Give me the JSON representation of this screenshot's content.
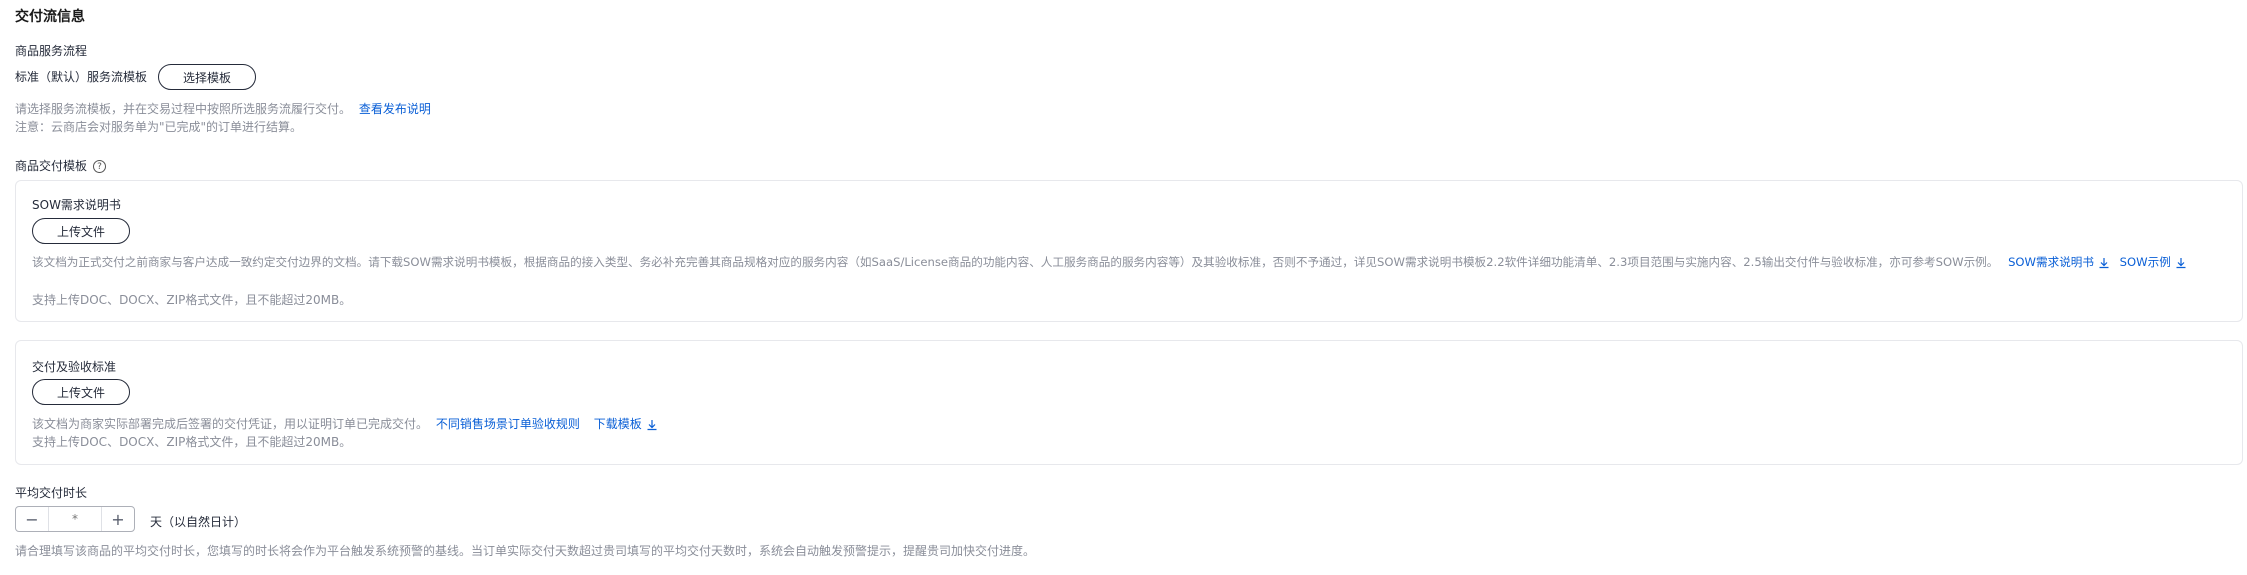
{
  "section_title": "交付流信息",
  "service_flow": {
    "label": "商品服务流程",
    "template_text": "标准（默认）服务流模板",
    "select_button": "选择模板",
    "hint": "请选择服务流模板，并在交易过程中按照所选服务流履行交付。",
    "hint_link": "查看发布说明",
    "note": "注意：云商店会对服务单为\"已完成\"的订单进行结算。"
  },
  "delivery_template": {
    "label": "商品交付模板",
    "help_icon": "question-circle-icon",
    "sow": {
      "title": "SOW需求说明书",
      "upload_button": "上传文件",
      "desc": "该文档为正式交付之前商家与客户达成一致约定交付边界的文档。请下载SOW需求说明书模板，根据商品的接入类型、务必补充完善其商品规格对应的服务内容（如SaaS/License商品的功能内容、人工服务商品的服务内容等）及其验收标准，否则不予通过，详见SOW需求说明书模板2.2软件详细功能清单、2.3项目范围与实施内容、2.5输出交付件与验收标准，亦可参考SOW示例。",
      "link1": "SOW需求说明书",
      "link2": "SOW示例",
      "formats": "支持上传DOC、DOCX、ZIP格式文件，且不能超过20MB。"
    },
    "acceptance": {
      "title": "交付及验收标准",
      "upload_button": "上传文件",
      "desc": "该文档为商家实际部署完成后签署的交付凭证，用以证明订单已完成交付。",
      "link1": "不同销售场景订单验收规则",
      "link2": "下载模板",
      "formats": "支持上传DOC、DOCX、ZIP格式文件，且不能超过20MB。"
    }
  },
  "avg_delivery": {
    "label": "平均交付时长",
    "minus": "−",
    "plus": "+",
    "value": "",
    "placeholder": "*",
    "unit": "天（以自然日计）",
    "hint": "请合理填写该商品的平均交付时长，您填写的时长将会作为平台触发系统预警的基线。当订单实际交付天数超过贵司填写的平均交付天数时，系统会自动触发预警提示，提醒贵司加快交付进度。"
  },
  "colors": {
    "link": "#0a5fd6",
    "text": "#252b3a",
    "hint": "#8a8e99",
    "border": "#e7e8ec"
  }
}
